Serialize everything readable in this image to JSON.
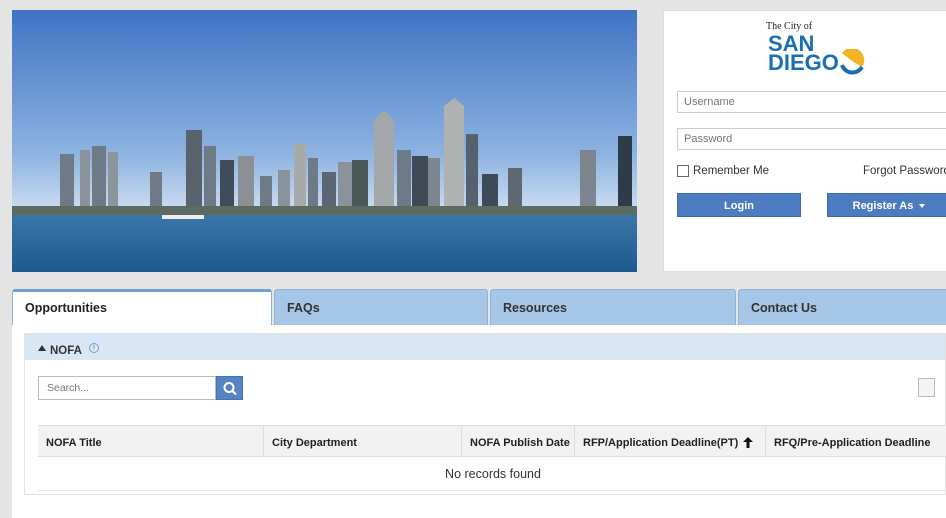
{
  "login": {
    "logo_small": "The City of",
    "logo_line1": "SAN",
    "logo_line2": "DIEGO",
    "username_placeholder": "Username",
    "password_placeholder": "Password",
    "remember_label": "Remember Me",
    "forgot_label": "Forgot Password?",
    "login_label": "Login",
    "register_label": "Register As"
  },
  "tabs": [
    {
      "label": "Opportunities",
      "active": true
    },
    {
      "label": "FAQs",
      "active": false
    },
    {
      "label": "Resources",
      "active": false
    },
    {
      "label": "Contact Us",
      "active": false
    }
  ],
  "section": {
    "title": "NOFA",
    "search_placeholder": "Search...",
    "columns": [
      "NOFA Title",
      "City Department",
      "NOFA Publish Date",
      "RFP/Application Deadline(PT)",
      "RFQ/Pre-Application Deadline"
    ],
    "empty_message": "No records found"
  },
  "colors": {
    "accent": "#4d7bbf",
    "tab_bg": "#a6c6e6",
    "section_header": "#d9e6f3",
    "logo_blue": "#1a6fb3"
  },
  "icons": [
    "info-icon",
    "search-icon",
    "sort-up-arrow-icon",
    "caret-down-icon",
    "column-toggle-icon"
  ]
}
